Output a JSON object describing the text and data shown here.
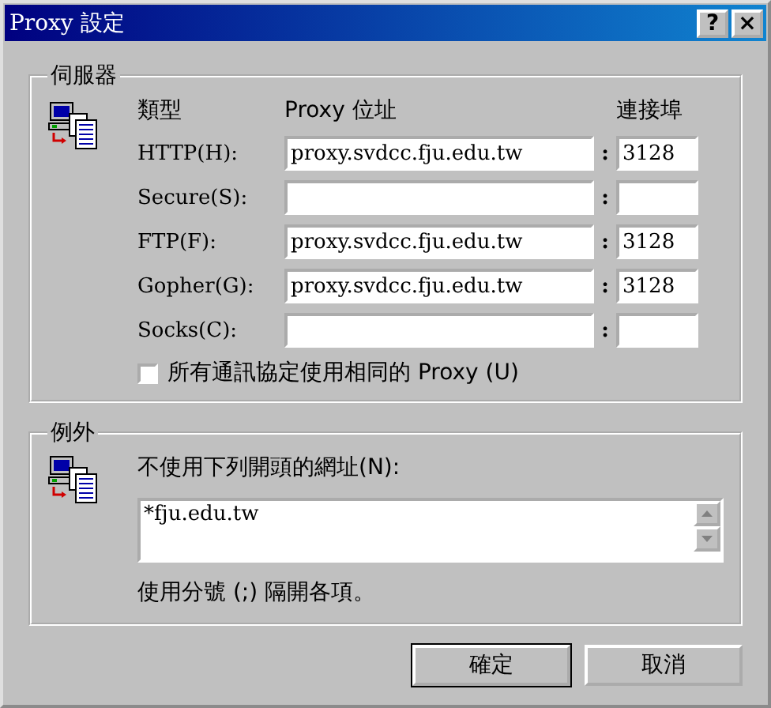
{
  "window": {
    "title": "Proxy 設定",
    "controls": [
      "?",
      "×"
    ]
  },
  "servers": {
    "title": "伺服器",
    "headers": [
      "類型",
      "Proxy 位址",
      "連接埠"
    ],
    "rows": [
      {
        "label": "HTTP(H):",
        "address": "proxy.svdcc.fju.edu.tw",
        "separator": ":",
        "port": "3128"
      },
      {
        "label": "Secure(S):",
        "separator": ":"
      },
      {
        "label": "FTP(F):",
        "address": "proxy.svdcc.fju.edu.tw",
        "separator": ":",
        "port": "3128"
      },
      {
        "label": "Gopher(G):",
        "address": "proxy.svdcc.fju.edu.tw",
        "separator": ":",
        "port": "3128"
      },
      {
        "label": "Socks(C):",
        "separator": ":"
      }
    ],
    "same_proxy": {
      "label": "所有通訊協定使用相同的 Proxy (U)",
      "checked": false
    }
  },
  "exceptions": {
    "title": "例外",
    "label": "不使用下列開頭的網址(N):",
    "value": "*fju.edu.tw",
    "note": "使用分號 (;) 隔開各項。"
  },
  "buttons": [
    "確定",
    "取消"
  ]
}
